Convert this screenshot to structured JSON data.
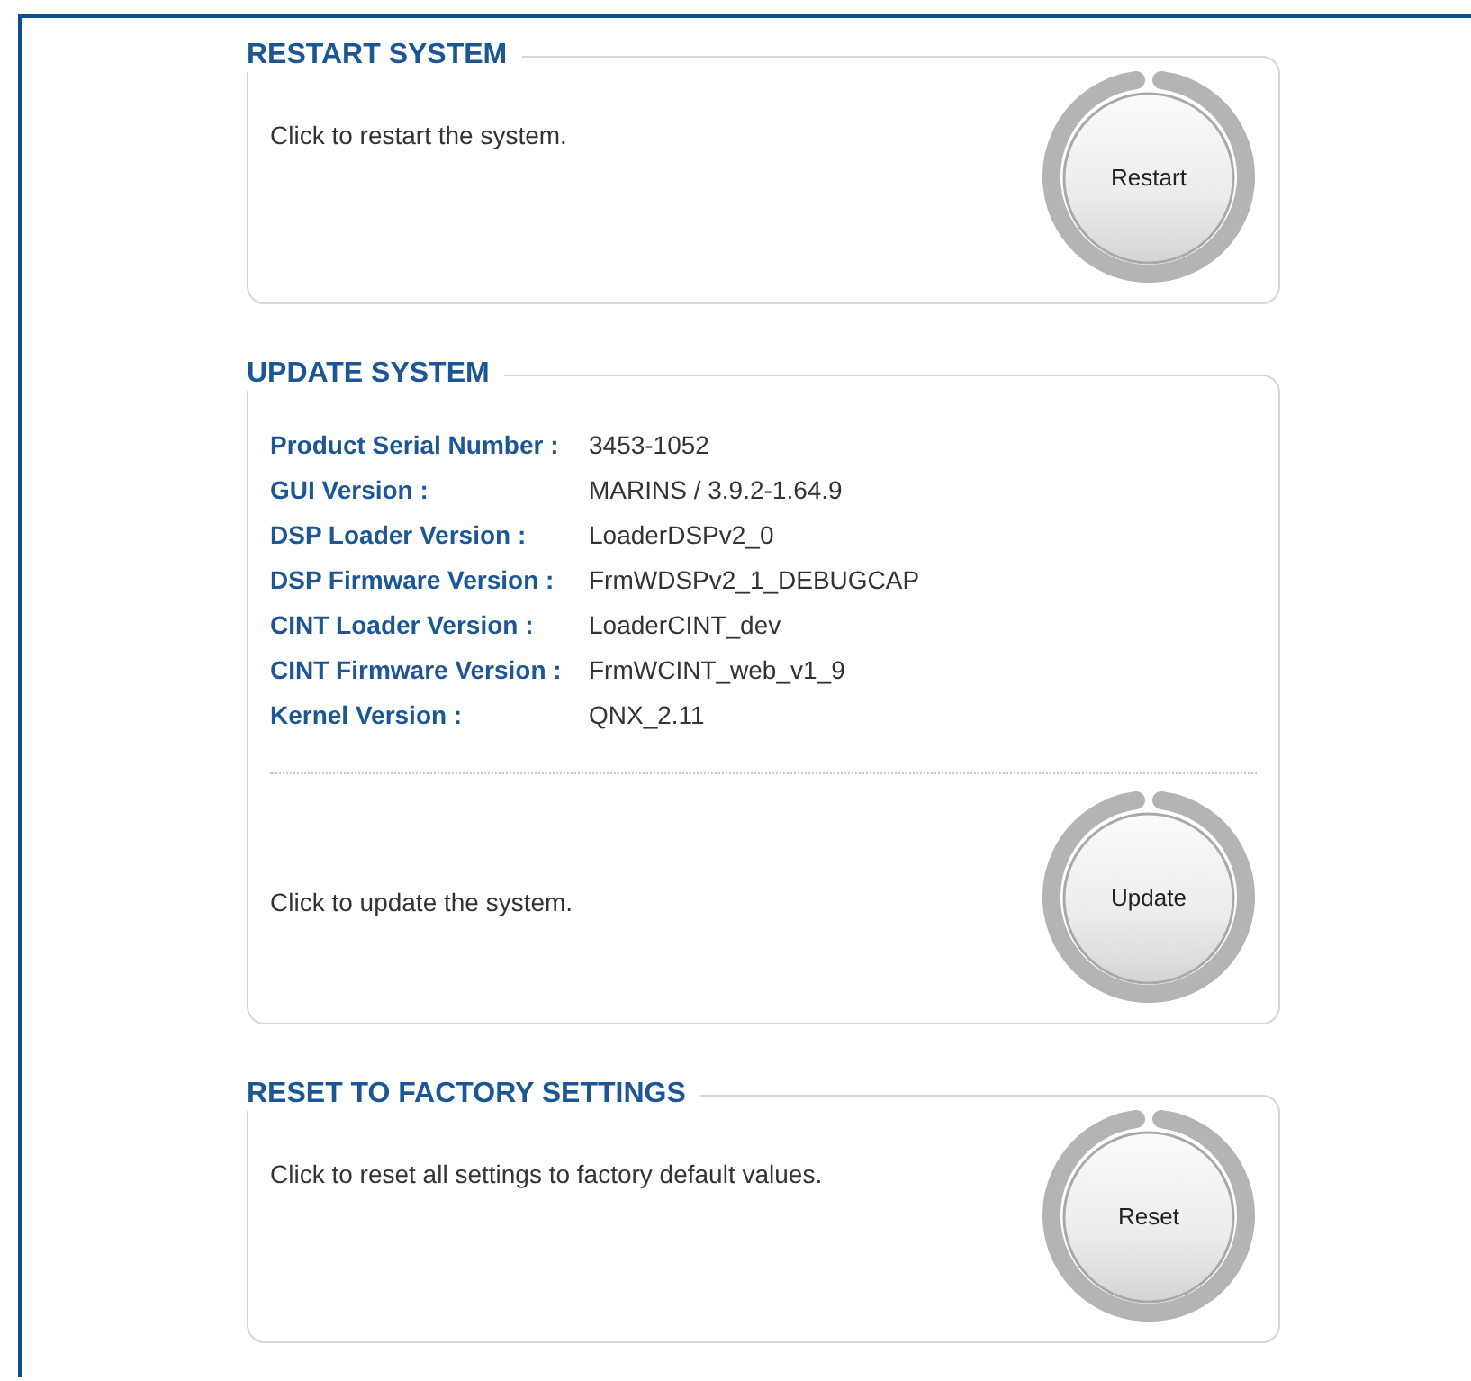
{
  "sections": [
    {
      "title": "RESTART SYSTEM",
      "description": "Click to restart the system.",
      "button": "Restart"
    },
    {
      "title": "UPDATE SYSTEM",
      "info": [
        {
          "label": "Product Serial Number :",
          "value": "3453-1052"
        },
        {
          "label": "GUI Version :",
          "value": "MARINS / 3.9.2-1.64.9"
        },
        {
          "label": "DSP Loader Version :",
          "value": "LoaderDSPv2_0"
        },
        {
          "label": "DSP Firmware Version :",
          "value": "FrmWDSPv2_1_DEBUGCAP"
        },
        {
          "label": "CINT Loader Version :",
          "value": "LoaderCINT_dev"
        },
        {
          "label": "CINT Firmware Version :",
          "value": "FrmWCINT_web_v1_9"
        },
        {
          "label": "Kernel Version :",
          "value": "QNX_2.11"
        }
      ],
      "description": "Click to update the system.",
      "button": "Update"
    },
    {
      "title": "RESET TO FACTORY SETTINGS",
      "description": "Click to reset all settings to factory default values.",
      "button": "Reset"
    }
  ]
}
